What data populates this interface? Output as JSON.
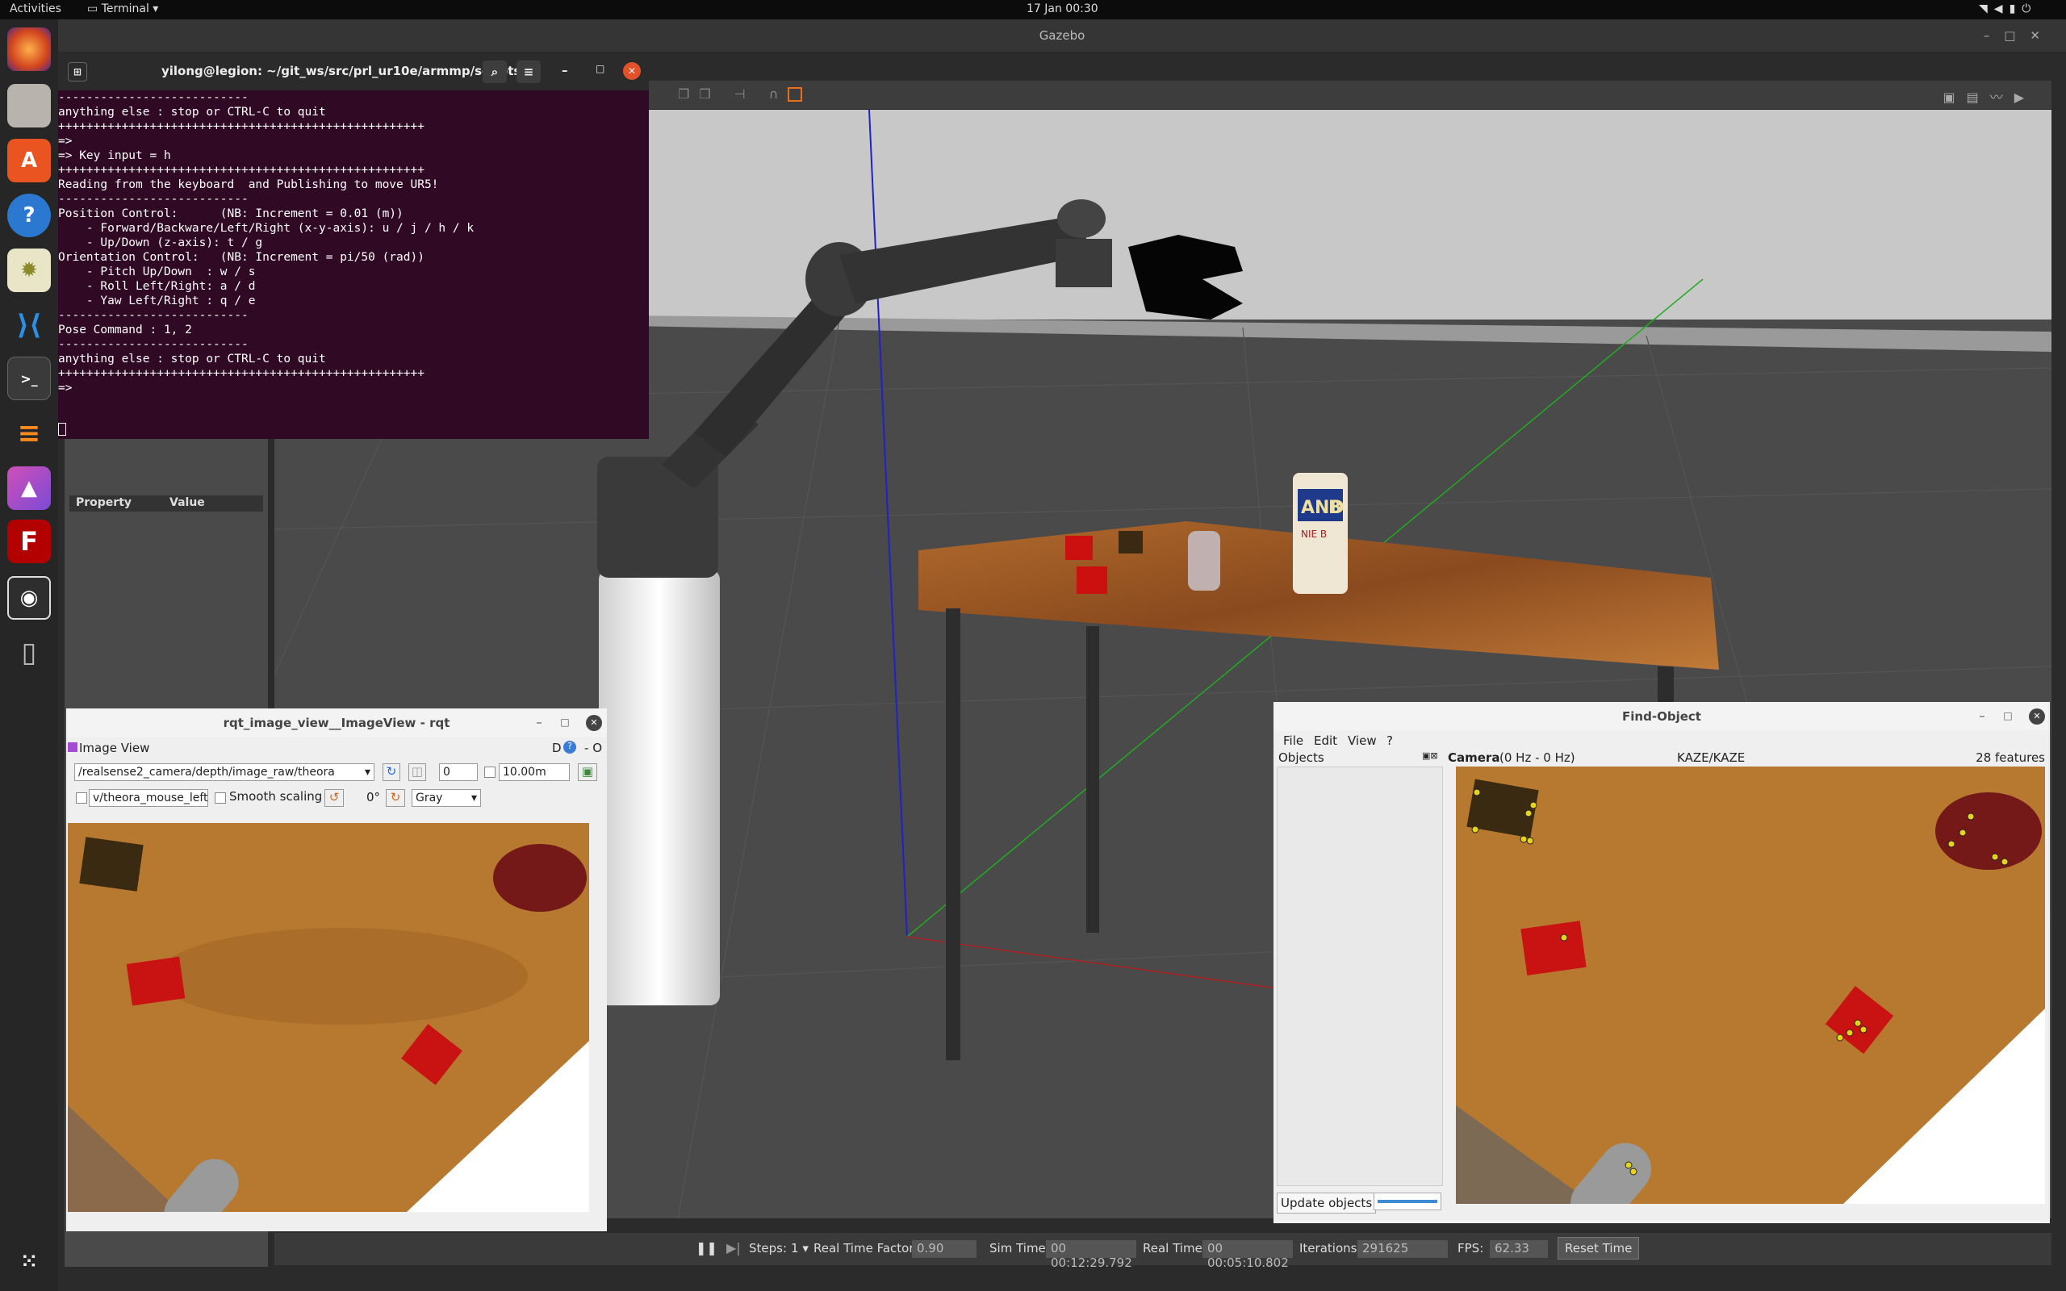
{
  "topbar": {
    "activities": "Activities",
    "app": "Terminal",
    "clock": "17 Jan  00:30"
  },
  "dock": [
    "firefox-icon",
    "files-icon",
    "software-icon",
    "help-icon",
    "settings-icon",
    "vscode-icon",
    "terminal-icon",
    "sublime-icon",
    "image-viewer-icon",
    "filezilla-icon",
    "camera-icon",
    "tablet-icon",
    "apps-grid-icon"
  ],
  "gazebo": {
    "title": "Gazebo",
    "left_panel": {
      "property": "Property",
      "value": "Value"
    },
    "status": {
      "steps_label": "Steps:",
      "steps": "1",
      "rtf_label": "Real Time Factor:",
      "rtf": "0.90",
      "sim_label": "Sim Time:",
      "sim": "00 00:12:29.792",
      "real_label": "Real Time:",
      "real": "00 00:05:10.802",
      "iter_label": "Iterations:",
      "iter": "291625",
      "fps_label": "FPS:",
      "fps": "62.33",
      "reset": "Reset Time"
    },
    "can_text": [
      "AND",
      "B",
      "NIE B"
    ]
  },
  "terminal": {
    "title": "yilong@legion: ~/git_ws/src/prl_ur10e/armmp/scripts",
    "lines": [
      "---------------------------",
      "anything else : stop or CTRL-C to quit",
      "++++++++++++++++++++++++++++++++++++++++++++++++++++",
      "=>",
      "=> Key input = h",
      "",
      "",
      "++++++++++++++++++++++++++++++++++++++++++++++++++++",
      "Reading from the keyboard  and Publishing to move UR5!",
      "---------------------------",
      "Position Control:      (NB: Increment = 0.01 (m))",
      "    - Forward/Backware/Left/Right (x-y-axis): u / j / h / k",
      "    - Up/Down (z-axis): t / g",
      "Orientation Control:   (NB: Increment = pi/50 (rad))",
      "    - Pitch Up/Down  : w / s",
      "    - Roll Left/Right: a / d",
      "    - Yaw Left/Right : q / e",
      "---------------------------",
      "Pose Command : 1, 2",
      "---------------------------",
      "anything else : stop or CTRL-C to quit",
      "++++++++++++++++++++++++++++++++++++++++++++++++++++",
      "=>"
    ]
  },
  "rqt": {
    "title": "rqt_image_view__ImageView - rqt",
    "panel": "Image View",
    "d_label": "D",
    "o_label": "O",
    "topic": "/realsense2_camera/depth/image_raw/theora",
    "spin": "0",
    "range": "10.00m",
    "mouse_topic": "v/theora_mouse_left",
    "smooth": "Smooth scaling",
    "rotation": "0°",
    "color": "Gray"
  },
  "find": {
    "title": "Find-Object",
    "menu": [
      "File",
      "Edit",
      "View",
      "?"
    ],
    "objects": "Objects",
    "camera": "Camera",
    "hz": "(0 Hz - 0 Hz)",
    "detector": "KAZE/KAZE",
    "features": "28 features",
    "update": "Update objects"
  }
}
